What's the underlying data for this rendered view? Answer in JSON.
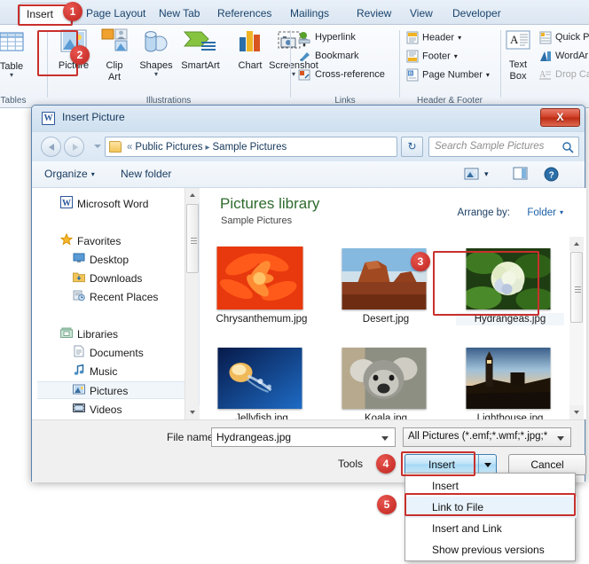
{
  "ribbon": {
    "tabs": [
      {
        "label": "Insert",
        "active": true
      },
      {
        "label": "Page Layout",
        "active": false
      },
      {
        "label": "New Tab",
        "active": false
      },
      {
        "label": "References",
        "active": false
      },
      {
        "label": "Mailings",
        "active": false
      },
      {
        "label": "Review",
        "active": false
      },
      {
        "label": "View",
        "active": false
      },
      {
        "label": "Developer",
        "active": false
      }
    ],
    "groups": [
      {
        "label": "Tables"
      },
      {
        "label": "Illustrations"
      },
      {
        "label": "Links"
      },
      {
        "label": "Header & Footer"
      },
      {
        "label": ""
      }
    ],
    "tables": {
      "big_label": "Table"
    },
    "illustrations": {
      "picture": "Picture",
      "clip_art_line1": "Clip",
      "clip_art_line2": "Art",
      "shapes": "Shapes",
      "smartart": "SmartArt",
      "chart": "Chart",
      "screenshot": "Screenshot"
    },
    "links": {
      "hyperlink": "Hyperlink",
      "bookmark": "Bookmark",
      "cross_reference": "Cross-reference"
    },
    "header_footer": {
      "header": "Header",
      "footer": "Footer",
      "page_number": "Page Number"
    },
    "text": {
      "text_box_line1": "Text",
      "text_box_line2": "Box",
      "quick_parts": "Quick Pa",
      "wordart": "WordAr",
      "drop_cap": "Drop Ca"
    }
  },
  "dialog": {
    "title": "Insert Picture",
    "close_label": "X",
    "app_icon_letter": "W",
    "address": {
      "chevrons": "«",
      "crumb1": "Public Pictures",
      "crumb2": "Sample Pictures",
      "separator": "▸",
      "refresh_glyph": "↻"
    },
    "search": {
      "placeholder": "Search Sample Pictures"
    },
    "command_bar": {
      "organize": "Organize",
      "new_folder": "New folder",
      "caret": "▾",
      "help_glyph": "?"
    },
    "nav_pane": {
      "items": [
        {
          "label": "Microsoft Word",
          "icon": "word-icon",
          "indent": 0,
          "selected": false
        },
        {
          "label": "Favorites",
          "icon": "star-icon",
          "indent": 0,
          "selected": false
        },
        {
          "label": "Desktop",
          "icon": "desktop-icon",
          "indent": 1,
          "selected": false
        },
        {
          "label": "Downloads",
          "icon": "downloads-icon",
          "indent": 1,
          "selected": false
        },
        {
          "label": "Recent Places",
          "icon": "recent-places-icon",
          "indent": 1,
          "selected": false
        },
        {
          "label": "Libraries",
          "icon": "libraries-icon",
          "indent": 0,
          "selected": false
        },
        {
          "label": "Documents",
          "icon": "documents-icon",
          "indent": 1,
          "selected": false
        },
        {
          "label": "Music",
          "icon": "music-icon",
          "indent": 1,
          "selected": false
        },
        {
          "label": "Pictures",
          "icon": "pictures-icon",
          "indent": 1,
          "selected": true
        },
        {
          "label": "Videos",
          "icon": "videos-icon",
          "indent": 1,
          "selected": false
        }
      ]
    },
    "library": {
      "title": "Pictures library",
      "subtitle": "Sample Pictures",
      "arrange_label": "Arrange by:",
      "arrange_value": "Folder",
      "arrange_caret": "▾"
    },
    "files": [
      {
        "name": "Chrysanthemum.jpg",
        "selected": false
      },
      {
        "name": "Desert.jpg",
        "selected": false
      },
      {
        "name": "Hydrangeas.jpg",
        "selected": true
      },
      {
        "name": "Jellyfish.jpg",
        "selected": false
      },
      {
        "name": "Koala.jpg",
        "selected": false
      },
      {
        "name": "Lighthouse.jpg",
        "selected": false
      }
    ],
    "footer": {
      "file_name_label": "File name:",
      "file_name_value": "Hydrangeas.jpg",
      "file_type_value": "All Pictures (*.emf;*.wmf;*.jpg;*",
      "tools_label": "Tools",
      "insert_label": "Insert",
      "cancel_label": "Cancel"
    },
    "dropdown_menu": {
      "items": [
        {
          "label": "Insert",
          "highlighted": false
        },
        {
          "label": "Link to File",
          "highlighted": true
        },
        {
          "label": "Insert and Link",
          "highlighted": false
        },
        {
          "label": "Show previous versions",
          "highlighted": false
        }
      ]
    }
  },
  "annotations": {
    "badges": [
      {
        "number": "1"
      },
      {
        "number": "2"
      },
      {
        "number": "3"
      },
      {
        "number": "4"
      },
      {
        "number": "5"
      }
    ],
    "accent_color": "#c9302c"
  }
}
